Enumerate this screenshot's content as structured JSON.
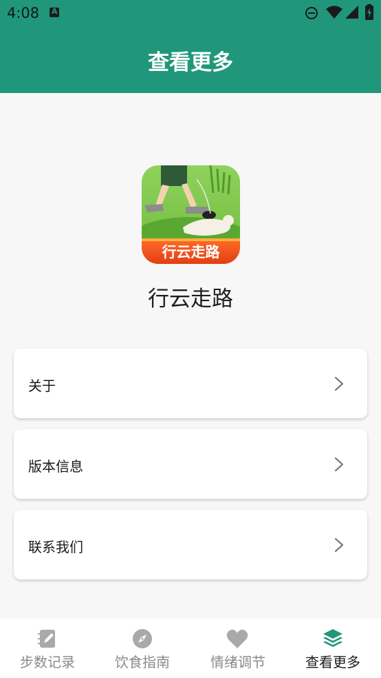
{
  "status_bar": {
    "time": "4:08",
    "icons": [
      "a-notification-icon",
      "do-not-disturb-icon",
      "wifi-icon",
      "signal-icon",
      "battery-icon"
    ]
  },
  "header": {
    "title": "查看更多"
  },
  "app_info": {
    "name": "行云走路",
    "logo_text": "行云走路"
  },
  "menu": {
    "items": [
      {
        "label": "关于"
      },
      {
        "label": "版本信息"
      },
      {
        "label": "联系我们"
      }
    ]
  },
  "bottom_nav": {
    "items": [
      {
        "label": "步数记录",
        "icon": "notebook-pencil-icon"
      },
      {
        "label": "饮食指南",
        "icon": "compass-icon"
      },
      {
        "label": "情绪调节",
        "icon": "heart-icon"
      },
      {
        "label": "查看更多",
        "icon": "layers-icon"
      }
    ],
    "active_index": 3
  },
  "colors": {
    "brand": "#20977a",
    "active_icon": "#20977a",
    "inactive": "#a9a9a9"
  }
}
